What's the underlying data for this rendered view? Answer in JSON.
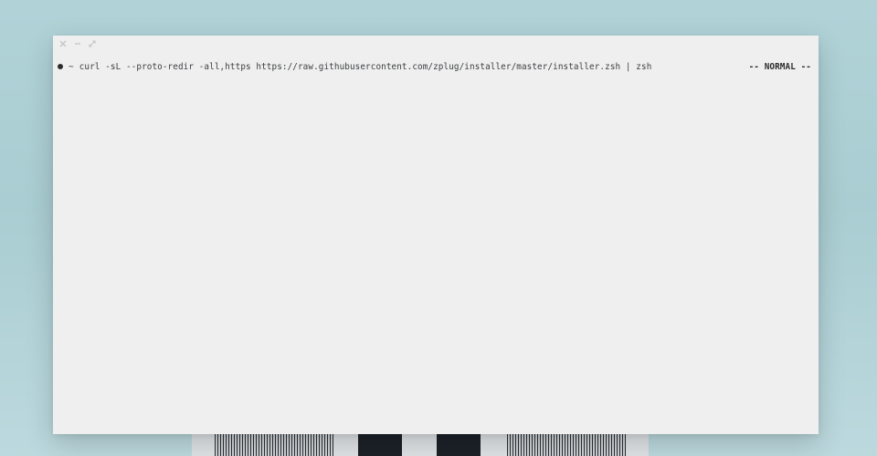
{
  "window": {
    "controls": [
      {
        "name": "close-button",
        "icon": "close-icon"
      },
      {
        "name": "minimize-button",
        "icon": "minimize-icon"
      },
      {
        "name": "maximize-button",
        "icon": "maximize-icon"
      }
    ]
  },
  "terminal": {
    "prompt_symbol": "~",
    "command": "curl -sL --proto-redir -all,https https://raw.githubusercontent.com/zplug/installer/master/installer.zsh | zsh",
    "mode_prefix": "--",
    "mode_name": "NORMAL",
    "mode_suffix": "--"
  },
  "colors": {
    "window_bg": "#efefef",
    "text": "#3b3d40",
    "desktop_bg": "#b1d3d8",
    "control_icons": "#c4c4c4"
  }
}
